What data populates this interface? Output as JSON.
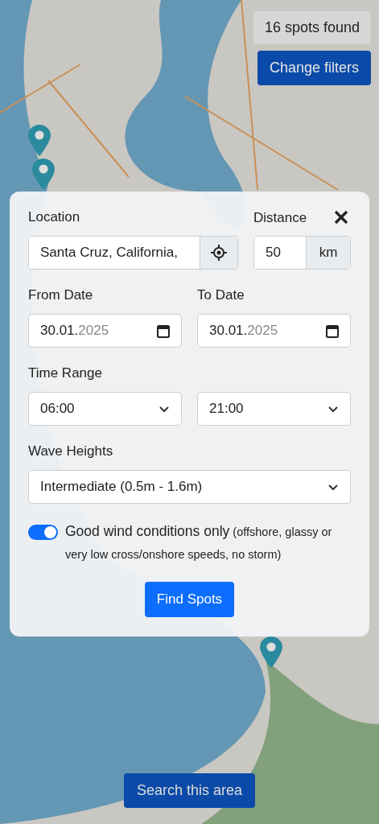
{
  "summary": {
    "count_text": "16 spots found",
    "change_button": "Change filters"
  },
  "map": {
    "pins": [
      {
        "kind": "spot"
      },
      {
        "kind": "spot"
      },
      {
        "kind": "spot"
      }
    ]
  },
  "filters": {
    "location": {
      "label": "Location",
      "value": "Santa Cruz, California,"
    },
    "distance": {
      "label": "Distance",
      "value": "50",
      "unit": "km"
    },
    "from_date": {
      "label": "From Date",
      "value": "30.01.",
      "value_dim": "2025"
    },
    "to_date": {
      "label": "To Date",
      "value": "30.01.",
      "value_dim": "2025"
    },
    "time_range": {
      "label": "Time Range",
      "start": "06:00",
      "end": "21:00"
    },
    "wave_heights": {
      "label": "Wave Heights",
      "value": "Intermediate (0.5m - 1.6m)"
    },
    "wind_toggle": {
      "on": true,
      "label": "Good wind conditions only",
      "note": "(offshore, glassy or very low cross/onshore speeds, no storm)"
    },
    "submit": "Find Spots"
  },
  "search_area_button": "Search this area"
}
